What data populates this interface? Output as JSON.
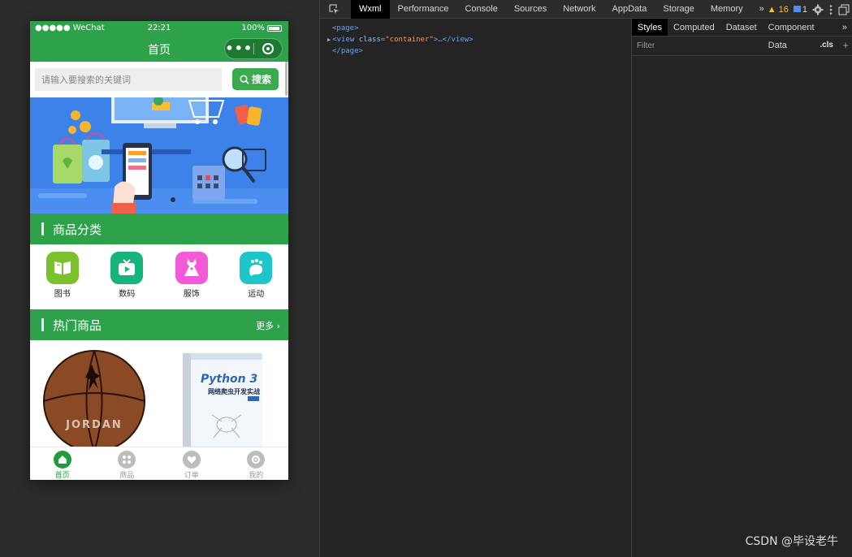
{
  "simulator": {
    "status": {
      "carrier": "●●●●● WeChat",
      "time": "22:21",
      "battery": "100%"
    },
    "nav": {
      "title": "首页",
      "more": "•••"
    },
    "search": {
      "placeholder": "请输入要搜索的关键词",
      "button": "搜索"
    },
    "sections": {
      "category": {
        "title": "商品分类"
      },
      "hot": {
        "title": "热门商品",
        "more": "更多 ›"
      }
    },
    "categories": [
      {
        "label": "图书",
        "icon": "book-icon",
        "color": "#7cc02e"
      },
      {
        "label": "数码",
        "icon": "video-icon",
        "color": "#16b37a"
      },
      {
        "label": "服饰",
        "icon": "dress-icon",
        "color": "#f25ad8"
      },
      {
        "label": "运动",
        "icon": "sport-icon",
        "color": "#1ec6c9"
      }
    ],
    "goods": {
      "basketball_text": "JORDAN",
      "book_title": "Python 3",
      "book_subtitle": "网络爬虫开发实战"
    },
    "tabbar": [
      {
        "label": "首页",
        "icon": "home-icon",
        "active": true
      },
      {
        "label": "商品",
        "icon": "grid-icon",
        "active": false
      },
      {
        "label": "订单",
        "icon": "heart-icon",
        "active": false
      },
      {
        "label": "我的",
        "icon": "user-icon",
        "active": false
      }
    ]
  },
  "devtools": {
    "tabs": [
      "Wxml",
      "Performance",
      "Console",
      "Sources",
      "Network",
      "AppData",
      "Storage",
      "Memory"
    ],
    "active_tab": "Wxml",
    "overflow": "»",
    "warnings": "▲ 16",
    "infos": "1",
    "dom": {
      "line1": "<page>",
      "line2_open": "<view",
      "line2_attr": "class",
      "line2_value": "\"container\"",
      "line2_rest": ">…</view>",
      "line3": "</page>"
    },
    "styles": {
      "tabs": [
        "Styles",
        "Computed",
        "Dataset",
        "Component Data"
      ],
      "overflow": "»",
      "filter_placeholder": "Filter",
      "cls": ".cls",
      "plus": "+"
    }
  },
  "watermark": "CSDN @毕设老牛"
}
